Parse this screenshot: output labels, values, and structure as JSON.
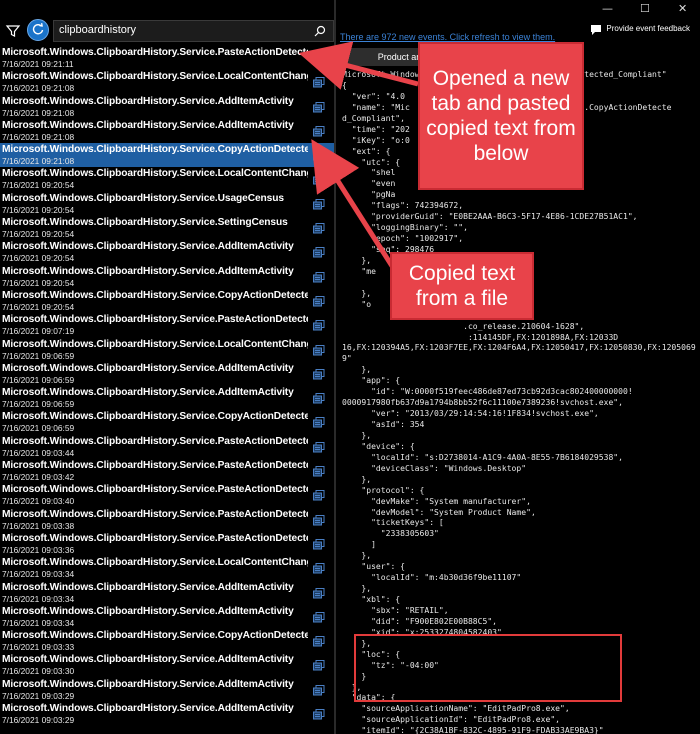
{
  "search": {
    "value": "clipboardhistory",
    "placeholder": ""
  },
  "events": [
    {
      "name": "Microsoft.Windows.ClipboardHistory.Service.PasteActionDetected_Compliant",
      "time": "7/16/2021 09:21:11",
      "selected": false
    },
    {
      "name": "Microsoft.Windows.ClipboardHistory.Service.LocalContentChangeListener_Do...",
      "time": "7/16/2021 09:21:08",
      "selected": false
    },
    {
      "name": "Microsoft.Windows.ClipboardHistory.Service.AddItemActivity",
      "time": "7/16/2021 09:21:08",
      "selected": false
    },
    {
      "name": "Microsoft.Windows.ClipboardHistory.Service.AddItemActivity",
      "time": "7/16/2021 09:21:08",
      "selected": false
    },
    {
      "name": "Microsoft.Windows.ClipboardHistory.Service.CopyActionDetected_Compliant",
      "time": "7/16/2021 09:21:08",
      "selected": true
    },
    {
      "name": "Microsoft.Windows.ClipboardHistory.Service.LocalContentChangeListener_Do...",
      "time": "7/16/2021 09:20:54",
      "selected": false
    },
    {
      "name": "Microsoft.Windows.ClipboardHistory.Service.UsageCensus",
      "time": "7/16/2021 09:20:54",
      "selected": false
    },
    {
      "name": "Microsoft.Windows.ClipboardHistory.Service.SettingCensus",
      "time": "7/16/2021 09:20:54",
      "selected": false
    },
    {
      "name": "Microsoft.Windows.ClipboardHistory.Service.AddItemActivity",
      "time": "7/16/2021 09:20:54",
      "selected": false
    },
    {
      "name": "Microsoft.Windows.ClipboardHistory.Service.AddItemActivity",
      "time": "7/16/2021 09:20:54",
      "selected": false
    },
    {
      "name": "Microsoft.Windows.ClipboardHistory.Service.CopyActionDetected_Compliant",
      "time": "7/16/2021 09:20:54",
      "selected": false
    },
    {
      "name": "Microsoft.Windows.ClipboardHistory.Service.PasteActionDetected_Compliant",
      "time": "7/16/2021 09:07:19",
      "selected": false
    },
    {
      "name": "Microsoft.Windows.ClipboardHistory.Service.LocalContentChangeListener_Do...",
      "time": "7/16/2021 09:06:59",
      "selected": false
    },
    {
      "name": "Microsoft.Windows.ClipboardHistory.Service.AddItemActivity",
      "time": "7/16/2021 09:06:59",
      "selected": false
    },
    {
      "name": "Microsoft.Windows.ClipboardHistory.Service.AddItemActivity",
      "time": "7/16/2021 09:06:59",
      "selected": false
    },
    {
      "name": "Microsoft.Windows.ClipboardHistory.Service.CopyActionDetected_Compliant",
      "time": "7/16/2021 09:06:59",
      "selected": false
    },
    {
      "name": "Microsoft.Windows.ClipboardHistory.Service.PasteActionDetected_Compliant",
      "time": "7/16/2021 09:03:44",
      "selected": false
    },
    {
      "name": "Microsoft.Windows.ClipboardHistory.Service.PasteActionDetected_Compliant",
      "time": "7/16/2021 09:03:42",
      "selected": false
    },
    {
      "name": "Microsoft.Windows.ClipboardHistory.Service.PasteActionDetected_Compliant",
      "time": "7/16/2021 09:03:40",
      "selected": false
    },
    {
      "name": "Microsoft.Windows.ClipboardHistory.Service.PasteActionDetected_Compliant",
      "time": "7/16/2021 09:03:38",
      "selected": false
    },
    {
      "name": "Microsoft.Windows.ClipboardHistory.Service.PasteActionDetected_Compliant",
      "time": "7/16/2021 09:03:36",
      "selected": false
    },
    {
      "name": "Microsoft.Windows.ClipboardHistory.Service.LocalContentChangeListener_Do...",
      "time": "7/16/2021 09:03:34",
      "selected": false
    },
    {
      "name": "Microsoft.Windows.ClipboardHistory.Service.AddItemActivity",
      "time": "7/16/2021 09:03:34",
      "selected": false
    },
    {
      "name": "Microsoft.Windows.ClipboardHistory.Service.AddItemActivity",
      "time": "7/16/2021 09:03:34",
      "selected": false
    },
    {
      "name": "Microsoft.Windows.ClipboardHistory.Service.CopyActionDetected_Compliant",
      "time": "7/16/2021 09:03:33",
      "selected": false
    },
    {
      "name": "Microsoft.Windows.ClipboardHistory.Service.AddItemActivity",
      "time": "7/16/2021 09:03:30",
      "selected": false
    },
    {
      "name": "Microsoft.Windows.ClipboardHistory.Service.AddItemActivity",
      "time": "7/16/2021 09:03:29",
      "selected": false
    },
    {
      "name": "Microsoft.Windows.ClipboardHistory.Service.AddItemActivity",
      "time": "7/16/2021 09:03:29",
      "selected": false
    }
  ],
  "right": {
    "new_events": "There are 972 new events. Click refresh to view them.",
    "feedback": "Provide event feedback",
    "tab_product": "Product and",
    "window_min": "—",
    "window_max": "☐",
    "window_close": "✕"
  },
  "json_lines": [
    "Microsoft.Window                              onDetected_Compliant\"",
    "{",
    "  \"ver\": \"4.0",
    "  \"name\": \"Mic                                 ice.CopyActionDetecte",
    "d_Compliant\",",
    "  \"time\": \"202",
    "  \"iKey\": \"o:0",
    "  \"ext\": {",
    "    \"utc\": {",
    "      \"shel",
    "      \"even",
    "      \"pgNa",
    "      \"flags\": 742394672,",
    "      \"providerGuid\": \"E0BE2AAA-B6C3-5F17-4E86-1CDE27B51AC1\",",
    "      \"loggingBinary\": \"\",",
    "      \"epoch\": \"1002917\",",
    "      \"seq\": 298476",
    "    },",
    "    \"me",
    "",
    "    },",
    "    \"o",
    "",
    "                         .co_release.210604-1628\",",
    "                          :114145DF,FX:1201898A,FX:12033D",
    "16,FX:120394A5,FX:1203F7EE,FX:1204F6A4,FX:12050417,FX:12050830,FX:1205069",
    "9\"",
    "    },",
    "    \"app\": {",
    "      \"id\": \"W:0000f519feec486de87ed73cb92d3cac802400000000!",
    "0000917980fb637d9a1794b8bb52f6c11100e7389236!svchost.exe\",",
    "      \"ver\": \"2013/03/29:14:54:16!1F834!svchost.exe\",",
    "      \"asId\": 354",
    "    },",
    "    \"device\": {",
    "      \"localId\": \"s:D2738014-A1C9-4A0A-8E55-7B6184029538\",",
    "      \"deviceClass\": \"Windows.Desktop\"",
    "    },",
    "    \"protocol\": {",
    "      \"devMake\": \"System manufacturer\",",
    "      \"devModel\": \"System Product Name\",",
    "      \"ticketKeys\": [",
    "        \"2338305603\"",
    "      ]",
    "    },",
    "    \"user\": {",
    "      \"localId\": \"m:4b30d36f9be11107\"",
    "    },",
    "    \"xbl\": {",
    "      \"sbx\": \"RETAIL\",",
    "      \"did\": \"F900E802E00B88C5\",",
    "      \"xid\": \"x:2533274804582403\"",
    "    },",
    "    \"loc\": {",
    "      \"tz\": \"-04:00\"",
    "    }",
    "  },",
    "  \"data\": {",
    "    \"sourceApplicationName\": \"EditPadPro8.exe\",",
    "    \"sourceApplicationId\": \"EditPadPro8.exe\",",
    "    \"itemId\": \"{2C38A1BF-832C-4895-91F9-FDAB33AE9BA3}\"",
    "  }",
    "}"
  ],
  "annotations": {
    "top": "Opened a new tab and pasted copied text from below",
    "bottom": "Copied text from a file",
    "color": "#e8434a"
  },
  "colors": {
    "selected_row": "#1f5fa3",
    "accent": "#1a73c9",
    "link": "#3b82d6"
  }
}
